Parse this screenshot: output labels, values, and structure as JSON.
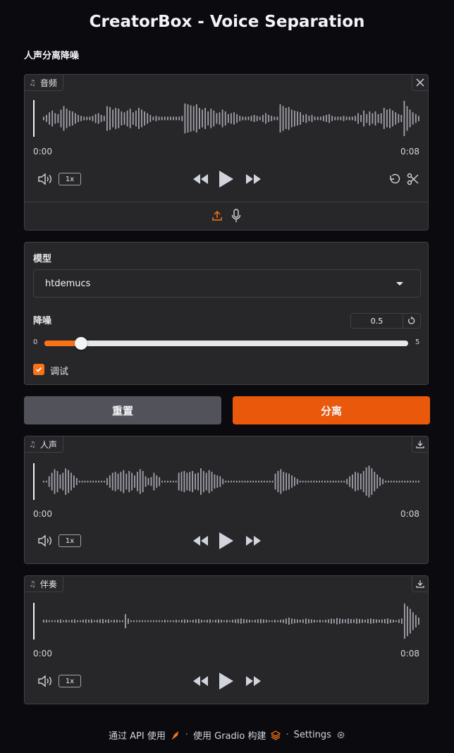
{
  "title": "CreatorBox - Voice Separation",
  "subtitle": "人声分离降噪",
  "input_audio": {
    "label": "音频",
    "time_start": "0:00",
    "time_end": "0:08",
    "playback_rate": "1x",
    "icons": [
      "music-note-icon",
      "close-icon",
      "volume-icon",
      "rewind-icon",
      "play-icon",
      "fast-forward-icon",
      "undo-icon",
      "scissors-icon",
      "upload-icon",
      "microphone-icon"
    ],
    "waveform": [
      0.1,
      0.2,
      0.35,
      0.45,
      0.3,
      0.25,
      0.5,
      0.7,
      0.55,
      0.45,
      0.4,
      0.3,
      0.2,
      0.15,
      0.1,
      0.1,
      0.1,
      0.15,
      0.25,
      0.3,
      0.2,
      0.15,
      0.7,
      0.65,
      0.5,
      0.6,
      0.55,
      0.4,
      0.35,
      0.45,
      0.55,
      0.35,
      0.45,
      0.6,
      0.5,
      0.4,
      0.3,
      0.2,
      0.1,
      0.15,
      0.1,
      0.1,
      0.1,
      0.1,
      0.1,
      0.1,
      0.1,
      0.1,
      0.15,
      0.85,
      0.8,
      0.75,
      0.7,
      0.8,
      0.6,
      0.5,
      0.6,
      0.4,
      0.55,
      0.45,
      0.3,
      0.35,
      0.5,
      0.4,
      0.25,
      0.3,
      0.35,
      0.25,
      0.15,
      0.1,
      0.1,
      0.1,
      0.15,
      0.2,
      0.15,
      0.1,
      0.2,
      0.3,
      0.2,
      0.15,
      0.1,
      0.1,
      0.8,
      0.7,
      0.6,
      0.65,
      0.5,
      0.45,
      0.4,
      0.35,
      0.2,
      0.25,
      0.15,
      0.2,
      0.1,
      0.1,
      0.1,
      0.15,
      0.2,
      0.25,
      0.15,
      0.1,
      0.1,
      0.1,
      0.15,
      0.1,
      0.1,
      0.1,
      0.15,
      0.3,
      0.2,
      0.45,
      0.25,
      0.4,
      0.3,
      0.4,
      0.25,
      0.3,
      0.6,
      0.5,
      0.55,
      0.45,
      0.35,
      0.25,
      0.2,
      1.0,
      0.7,
      0.5,
      0.35,
      0.25,
      0.15
    ]
  },
  "settings": {
    "model_label": "模型",
    "model_value": "htdemucs",
    "denoise_label": "降噪",
    "denoise_value": "0.5",
    "slider_min": "0",
    "slider_max": "5",
    "slider_fraction": 0.1,
    "debug_label": "调试",
    "debug_checked": true
  },
  "buttons": {
    "reset_label": "重置",
    "separate_label": "分离"
  },
  "vocals_audio": {
    "label": "人声",
    "time_start": "0:00",
    "time_end": "0:08",
    "playback_rate": "1x",
    "waveform": [
      0.05,
      0.05,
      0.3,
      0.5,
      0.7,
      0.6,
      0.4,
      0.5,
      0.75,
      0.65,
      0.5,
      0.35,
      0.2,
      0.05,
      0.05,
      0.05,
      0.05,
      0.05,
      0.05,
      0.05,
      0.05,
      0.05,
      0.05,
      0.2,
      0.35,
      0.5,
      0.55,
      0.45,
      0.55,
      0.65,
      0.45,
      0.6,
      0.5,
      0.35,
      0.55,
      0.7,
      0.6,
      0.3,
      0.2,
      0.25,
      0.5,
      0.35,
      0.25,
      0.05,
      0.05,
      0.05,
      0.05,
      0.05,
      0.05,
      0.5,
      0.55,
      0.6,
      0.5,
      0.55,
      0.6,
      0.45,
      0.5,
      0.75,
      0.6,
      0.5,
      0.65,
      0.55,
      0.4,
      0.35,
      0.3,
      0.15,
      0.05,
      0.05,
      0.05,
      0.05,
      0.05,
      0.05,
      0.05,
      0.05,
      0.05,
      0.05,
      0.05,
      0.05,
      0.05,
      0.05,
      0.05,
      0.05,
      0.05,
      0.05,
      0.45,
      0.6,
      0.7,
      0.55,
      0.5,
      0.45,
      0.35,
      0.25,
      0.15,
      0.05,
      0.05,
      0.05,
      0.05,
      0.05,
      0.05,
      0.05,
      0.05,
      0.05,
      0.05,
      0.05,
      0.05,
      0.05,
      0.05,
      0.05,
      0.05,
      0.05,
      0.15,
      0.3,
      0.4,
      0.55,
      0.5,
      0.45,
      0.6,
      0.8,
      0.9,
      0.75,
      0.55,
      0.4,
      0.25,
      0.15,
      0.05,
      0.05,
      0.05,
      0.05,
      0.05,
      0.05,
      0.05,
      0.05,
      0.05,
      0.05,
      0.05,
      0.05,
      0.05
    ]
  },
  "accompaniment_audio": {
    "label": "伴奏",
    "time_start": "0:00",
    "time_end": "0:08",
    "playback_rate": "1x",
    "waveform": [
      0.08,
      0.08,
      0.05,
      0.05,
      0.05,
      0.08,
      0.1,
      0.05,
      0.08,
      0.05,
      0.08,
      0.1,
      0.05,
      0.05,
      0.08,
      0.1,
      0.08,
      0.1,
      0.05,
      0.08,
      0.1,
      0.12,
      0.08,
      0.1,
      0.05,
      0.08,
      0.08,
      0.05,
      0.05,
      0.4,
      0.15,
      0.05,
      0.05,
      0.05,
      0.05,
      0.05,
      0.05,
      0.05,
      0.05,
      0.05,
      0.05,
      0.05,
      0.05,
      0.08,
      0.05,
      0.05,
      0.05,
      0.08,
      0.05,
      0.08,
      0.1,
      0.08,
      0.05,
      0.08,
      0.1,
      0.12,
      0.08,
      0.05,
      0.08,
      0.1,
      0.05,
      0.08,
      0.1,
      0.08,
      0.05,
      0.08,
      0.05,
      0.08,
      0.1,
      0.12,
      0.15,
      0.12,
      0.1,
      0.08,
      0.05,
      0.08,
      0.1,
      0.12,
      0.1,
      0.08,
      0.05,
      0.05,
      0.08,
      0.05,
      0.08,
      0.1,
      0.15,
      0.2,
      0.15,
      0.12,
      0.1,
      0.08,
      0.1,
      0.15,
      0.12,
      0.1,
      0.08,
      0.05,
      0.08,
      0.05,
      0.08,
      0.1,
      0.15,
      0.12,
      0.18,
      0.15,
      0.12,
      0.1,
      0.15,
      0.12,
      0.1,
      0.15,
      0.12,
      0.1,
      0.08,
      0.12,
      0.15,
      0.12,
      0.1,
      0.08,
      0.1,
      0.12,
      0.15,
      0.1,
      0.08,
      0.05,
      0.1,
      0.15,
      1.0,
      0.85,
      0.7,
      0.5,
      0.35,
      0.2
    ]
  },
  "footer": {
    "api_label": "通过 API 使用",
    "gradio_label": "使用 Gradio 构建",
    "settings_label": "Settings",
    "separator": "·"
  }
}
